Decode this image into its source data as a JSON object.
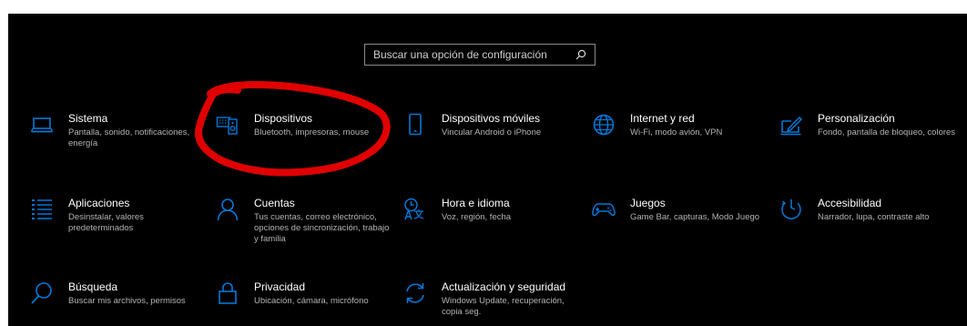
{
  "search": {
    "placeholder": "Buscar una opción de configuración"
  },
  "accent_color": "#0078d7",
  "annotation_color": "#e00000",
  "tiles": [
    {
      "icon": "laptop-icon",
      "title": "Sistema",
      "desc": "Pantalla, sonido, notificaciones, energía"
    },
    {
      "icon": "keyboard-speaker-icon",
      "title": "Dispositivos",
      "desc": "Bluetooth, impresoras, mouse"
    },
    {
      "icon": "phone-icon",
      "title": "Dispositivos móviles",
      "desc": "Vincular Android o iPhone"
    },
    {
      "icon": "globe-icon",
      "title": "Internet y red",
      "desc": "Wi-Fi, modo avión, VPN"
    },
    {
      "icon": "pen-tablet-icon",
      "title": "Personalización",
      "desc": "Fondo, pantalla de bloqueo, colores"
    },
    {
      "icon": "apps-list-icon",
      "title": "Aplicaciones",
      "desc": "Desinstalar, valores predeterminados"
    },
    {
      "icon": "person-icon",
      "title": "Cuentas",
      "desc": "Tus cuentas, correo electrónico, opciones de sincronización, trabajo y familia"
    },
    {
      "icon": "time-language-icon",
      "title": "Hora e idioma",
      "desc": "Voz, región, fecha"
    },
    {
      "icon": "gamepad-icon",
      "title": "Juegos",
      "desc": "Game Bar, capturas, Modo Juego"
    },
    {
      "icon": "accessibility-icon",
      "title": "Accesibilidad",
      "desc": "Narrador, lupa, contraste alto"
    },
    {
      "icon": "search-icon",
      "title": "Búsqueda",
      "desc": "Buscar mis archivos, permisos"
    },
    {
      "icon": "lock-icon",
      "title": "Privacidad",
      "desc": "Ubicación, cámara, micrófono"
    },
    {
      "icon": "sync-icon",
      "title": "Actualización y seguridad",
      "desc": "Windows Update, recuperación, copia seg."
    }
  ]
}
